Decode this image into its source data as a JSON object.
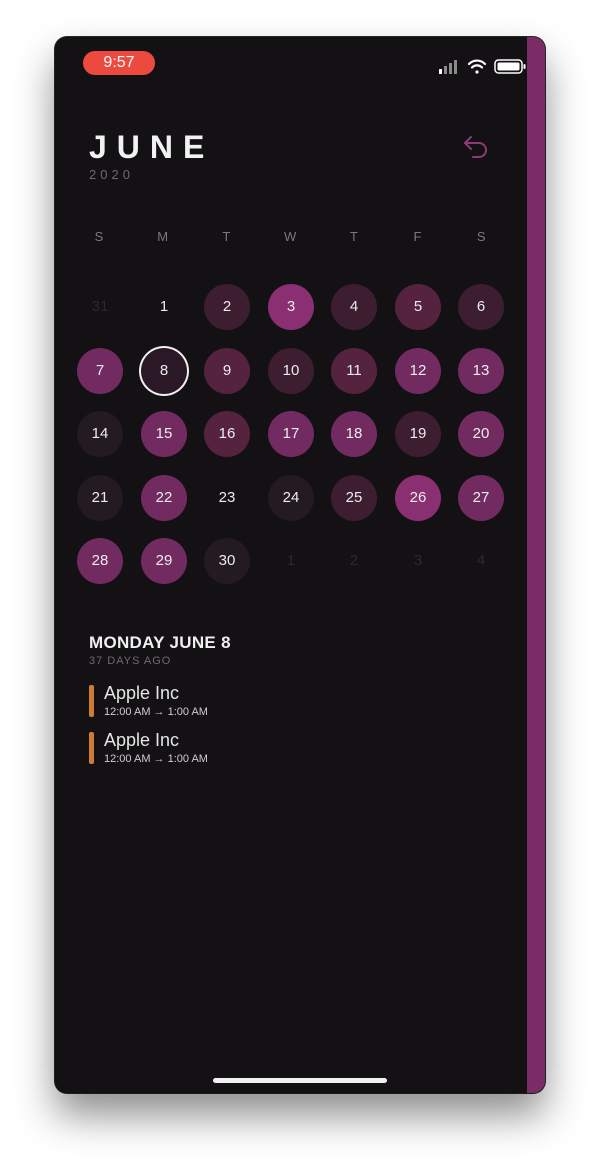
{
  "status_bar": {
    "time": "9:57",
    "icons": [
      "signal-icon",
      "wifi-icon",
      "battery-icon"
    ]
  },
  "header": {
    "month": "JUNE",
    "year": "2020",
    "undo_icon": "undo-arrow-icon"
  },
  "weekdays": [
    "S",
    "M",
    "T",
    "W",
    "T",
    "F",
    "S"
  ],
  "calendar": {
    "weeks": [
      [
        {
          "label": "31",
          "state": "outside"
        },
        {
          "label": "1",
          "state": "empty"
        },
        {
          "label": "2",
          "state": "faint"
        },
        {
          "label": "3",
          "state": "bright"
        },
        {
          "label": "4",
          "state": "faint"
        },
        {
          "label": "5",
          "state": "dim"
        },
        {
          "label": "6",
          "state": "faint"
        }
      ],
      [
        {
          "label": "7",
          "state": "medium"
        },
        {
          "label": "8",
          "state": "selected"
        },
        {
          "label": "9",
          "state": "dim"
        },
        {
          "label": "10",
          "state": "faint"
        },
        {
          "label": "11",
          "state": "dim"
        },
        {
          "label": "12",
          "state": "medium"
        },
        {
          "label": "13",
          "state": "medium"
        }
      ],
      [
        {
          "label": "14",
          "state": "darkest"
        },
        {
          "label": "15",
          "state": "medium"
        },
        {
          "label": "16",
          "state": "dim"
        },
        {
          "label": "17",
          "state": "medium"
        },
        {
          "label": "18",
          "state": "medium"
        },
        {
          "label": "19",
          "state": "faint"
        },
        {
          "label": "20",
          "state": "medium"
        }
      ],
      [
        {
          "label": "21",
          "state": "darkest"
        },
        {
          "label": "22",
          "state": "medium"
        },
        {
          "label": "23",
          "state": "empty"
        },
        {
          "label": "24",
          "state": "darkest"
        },
        {
          "label": "25",
          "state": "faint"
        },
        {
          "label": "26",
          "state": "bright"
        },
        {
          "label": "27",
          "state": "medium"
        }
      ],
      [
        {
          "label": "28",
          "state": "medium"
        },
        {
          "label": "29",
          "state": "medium"
        },
        {
          "label": "30",
          "state": "darkest"
        },
        {
          "label": "1",
          "state": "outside"
        },
        {
          "label": "2",
          "state": "outside"
        },
        {
          "label": "3",
          "state": "outside"
        },
        {
          "label": "4",
          "state": "outside"
        }
      ]
    ]
  },
  "colors": {
    "bright": "#8a2f71",
    "medium": "#722b60",
    "dim": "#55233f",
    "faint": "#3d1e30",
    "darkest": "#241a21",
    "selected": "#2a1826",
    "accent": "#7a2c66",
    "event_bar": "#d07b35",
    "time_pill": "#ec4a3f"
  },
  "selected_day": {
    "title": "MONDAY JUNE 8",
    "subtitle": "37 DAYS AGO",
    "events": [
      {
        "title": "Apple Inc",
        "time": "12:00 AM → 1:00 AM"
      },
      {
        "title": "Apple Inc",
        "time": "12:00 AM → 1:00 AM"
      }
    ]
  }
}
